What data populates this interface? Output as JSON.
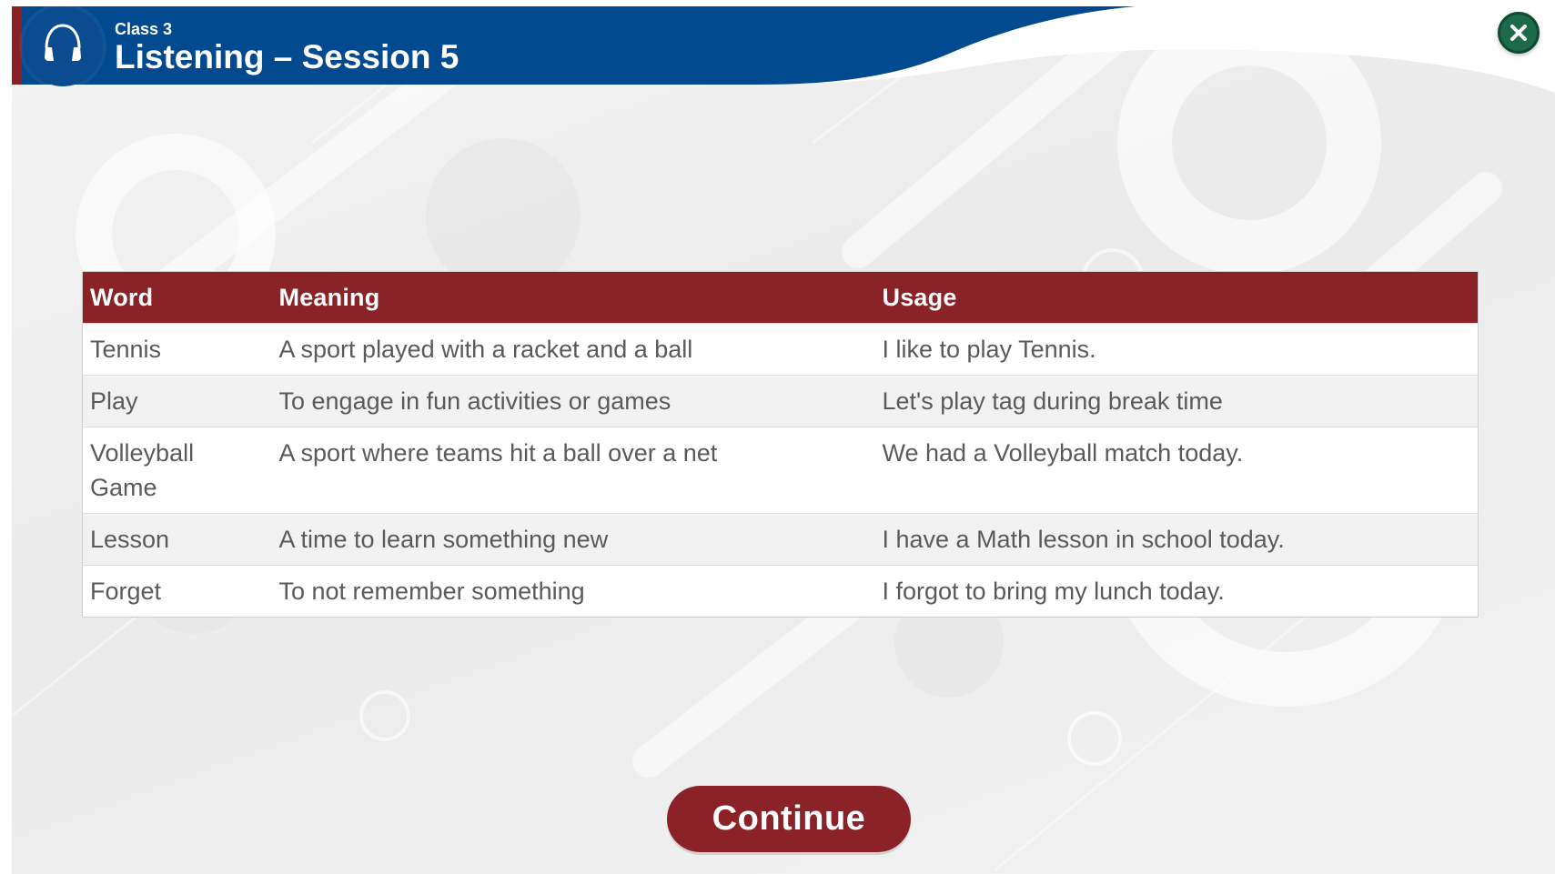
{
  "header": {
    "class_label": "Class 3",
    "title": "Listening – Session 5",
    "icon": "headphones-icon",
    "close_icon": "close-icon"
  },
  "table": {
    "columns": [
      "Word",
      "Meaning",
      "Usage"
    ],
    "rows": [
      {
        "word": "Tennis",
        "meaning": "A sport played with a racket and a ball",
        "usage": "I like to play Tennis."
      },
      {
        "word": "Play",
        "meaning": "To engage in fun activities or games",
        "usage": "Let's play tag during break time"
      },
      {
        "word": "Volleyball Game",
        "meaning": "A sport where teams hit a ball over a net",
        "usage": "We had a Volleyball match today."
      },
      {
        "word": "Lesson",
        "meaning": "A time to learn something new",
        "usage": "I have a Math lesson in school today."
      },
      {
        "word": "Forget",
        "meaning": "To not remember something",
        "usage": "I forgot to bring my lunch today."
      }
    ]
  },
  "footer": {
    "continue_label": "Continue"
  },
  "colors": {
    "header_blue": "#014a8f",
    "accent_red": "#8a1f24",
    "table_header": "#8a2328",
    "continue_button": "#8a2228",
    "close_button": "#1d6a4b",
    "cell_text": "#5a5a5a"
  }
}
